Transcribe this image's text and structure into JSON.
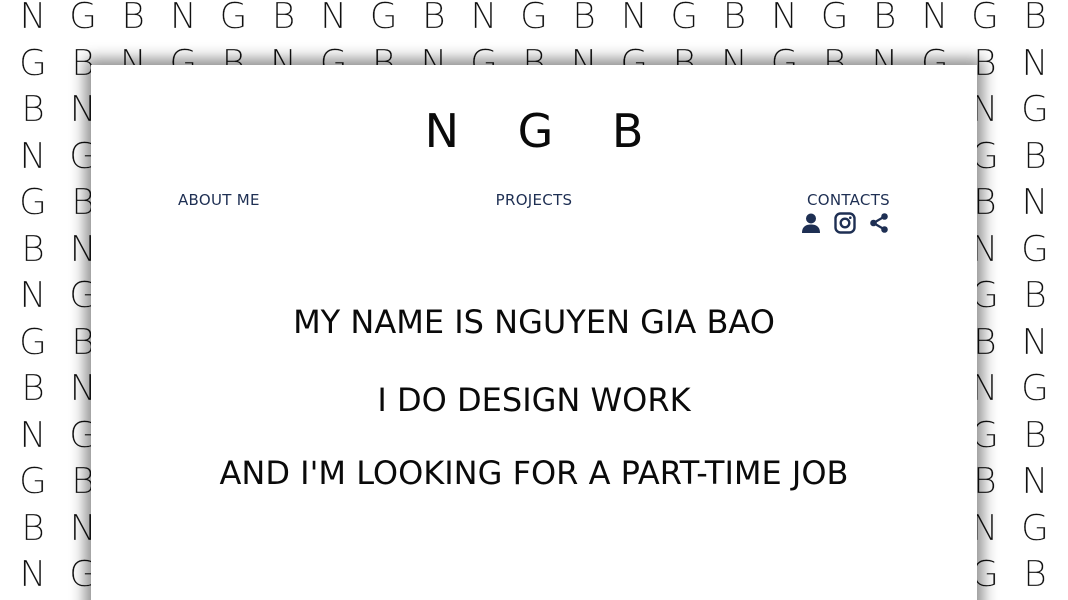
{
  "background": {
    "pattern_letters": [
      "N",
      "G",
      "B"
    ]
  },
  "header": {
    "logo": "N G B"
  },
  "nav": {
    "about": "ABOUT ME",
    "projects": "PROJECTS",
    "contacts": "CONTACTS"
  },
  "contact_icons": [
    "user-icon",
    "instagram-icon",
    "share-icon"
  ],
  "hero": {
    "line1": "MY NAME IS NGUYEN GIA BAO",
    "line2": "I DO DESIGN WORK",
    "line3": "AND I'M LOOKING FOR A PART-TIME JOB"
  },
  "colors": {
    "nav_text": "#1e2f53",
    "hero_text": "#0a0a0a",
    "icon": "#1e2f53"
  }
}
